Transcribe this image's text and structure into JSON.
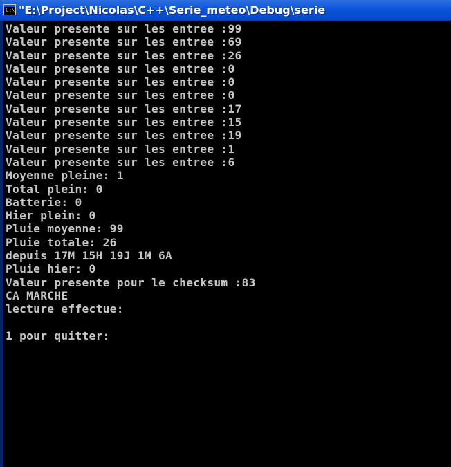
{
  "window": {
    "title": "\"E:\\Project\\Nicolas\\C++\\Serie_meteo\\Debug\\serie",
    "icon": "console-app-icon",
    "icon_text": "C:\\"
  },
  "console": {
    "text_color": "#c6c6c6",
    "background": "#000000",
    "lines": [
      "Valeur presente sur les entree :99",
      "Valeur presente sur les entree :69",
      "Valeur presente sur les entree :26",
      "Valeur presente sur les entree :0",
      "Valeur presente sur les entree :0",
      "Valeur presente sur les entree :0",
      "Valeur presente sur les entree :17",
      "Valeur presente sur les entree :15",
      "Valeur presente sur les entree :19",
      "Valeur presente sur les entree :1",
      "Valeur presente sur les entree :6",
      "Moyenne pleine: 1",
      "Total plein: 0",
      "Batterie: 0",
      "Hier plein: 0",
      "Pluie moyenne: 99",
      "Pluie totale: 26",
      "depuis 17M 15H 19J 1M 6A",
      "Pluie hier: 0",
      "Valeur presente pour le checksum :83",
      "CA MARCHE",
      "lecture effectue:",
      "",
      "1 pour quitter:"
    ]
  }
}
